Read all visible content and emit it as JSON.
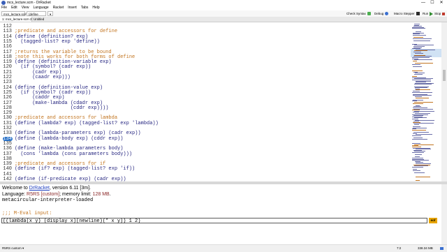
{
  "window": {
    "title": "mcs_lecture.scm - DrRacket",
    "minimize": "—",
    "maximize": "☐",
    "close": "✕"
  },
  "menu": [
    "File",
    "Edit",
    "View",
    "Language",
    "Racket",
    "Insert",
    "Tabs",
    "Help"
  ],
  "toolbar": {
    "file_dropdown": "mcs_lecture.scm▾",
    "define_dropdown": "(define ...)▾",
    "arrow": "▾",
    "check_syntax": "Check Syntax",
    "debug": "Debug",
    "macro_stepper": "Macro Stepper",
    "run": "Run",
    "stop": "Stop"
  },
  "tabs": [
    "1: mcs_lecture.scm",
    "2: Untitled"
  ],
  "code_lines": [
    {
      "n": "112",
      "t": "",
      "c": ""
    },
    {
      "n": "113",
      "t": ";predicate and accessors for define",
      "c": "cmt"
    },
    {
      "n": "114",
      "t": "(define (definition? exp)",
      "c": "def"
    },
    {
      "n": "115",
      "t": "  (tagged-list? exp 'define))",
      "c": "def"
    },
    {
      "n": "116",
      "t": "",
      "c": ""
    },
    {
      "n": "117",
      "t": ";returns the variable to be bound",
      "c": "cmt"
    },
    {
      "n": "118",
      "t": ";note this works for both forms of define",
      "c": "cmt"
    },
    {
      "n": "119",
      "t": "(define (definition-variable exp)",
      "c": "def"
    },
    {
      "n": "120",
      "t": "  (if (symbol? (cadr exp))",
      "c": "def"
    },
    {
      "n": "121",
      "t": "      (cadr exp)",
      "c": "def"
    },
    {
      "n": "122",
      "t": "      (caadr exp)))",
      "c": "def"
    },
    {
      "n": "123",
      "t": "",
      "c": ""
    },
    {
      "n": "124",
      "t": "(define (definition-value exp)",
      "c": "def"
    },
    {
      "n": "125",
      "t": "  (if (symbol? (cadr exp))",
      "c": "def"
    },
    {
      "n": "126",
      "t": "      (caddr exp)",
      "c": "def"
    },
    {
      "n": "127",
      "t": "      (make-lambda (cdadr exp)",
      "c": "def"
    },
    {
      "n": "128",
      "t": "                   (cddr exp))))",
      "c": "def"
    },
    {
      "n": "129",
      "t": "",
      "c": ""
    },
    {
      "n": "130",
      "t": ";predicate and accessors for lambda",
      "c": "cmt"
    },
    {
      "n": "131",
      "t": "(define (lambda? exp) (tagged-list? exp 'lambda))",
      "c": "def"
    },
    {
      "n": "132",
      "t": "",
      "c": ""
    },
    {
      "n": "133",
      "t": "(define (lambda-parameters exp) (cadr exp))",
      "c": "def"
    },
    {
      "n": "134",
      "t": "(define (lambda-body exp) (cddr exp))",
      "c": "def",
      "bp": true
    },
    {
      "n": "135",
      "t": "",
      "c": ""
    },
    {
      "n": "136",
      "t": "(define (make-lambda parameters body)",
      "c": "def"
    },
    {
      "n": "137",
      "t": "  (cons 'lambda (cons parameters body)))",
      "c": "def"
    },
    {
      "n": "138",
      "t": "",
      "c": ""
    },
    {
      "n": "139",
      "t": ";predicate and accessors for if",
      "c": "cmt"
    },
    {
      "n": "140",
      "t": "(define (if? exp) (tagged-list? exp 'if))",
      "c": "def"
    },
    {
      "n": "141",
      "t": "",
      "c": ""
    },
    {
      "n": "142",
      "t": "(define (if-predicate exp) (cadr exp))",
      "c": "def"
    }
  ],
  "repl": {
    "welcome_prefix": "Welcome to ",
    "welcome_link": "DrRacket",
    "welcome_suffix": ", version 6.11 [3m].",
    "language_prefix": "Language: ",
    "language_name": "R5RS [custom]",
    "language_mid": "; memory limit: ",
    "memory_limit": "128 MB",
    "language_end": ".",
    "loaded": "metacircular-interpreter-loaded",
    "prompt": ";;; M-Eval input:",
    "input_value": "((lambda(x y) (display x)(newline)(* x y)) 1 2)",
    "eof_label": "eof"
  },
  "status": {
    "language": "R5RS custom ▾",
    "position": "7:2",
    "memory": "338.34 MB"
  },
  "colors": {
    "comment": "#c2741f",
    "code": "#262680",
    "accent": "#2a72c8",
    "eof": "#e8a400"
  }
}
